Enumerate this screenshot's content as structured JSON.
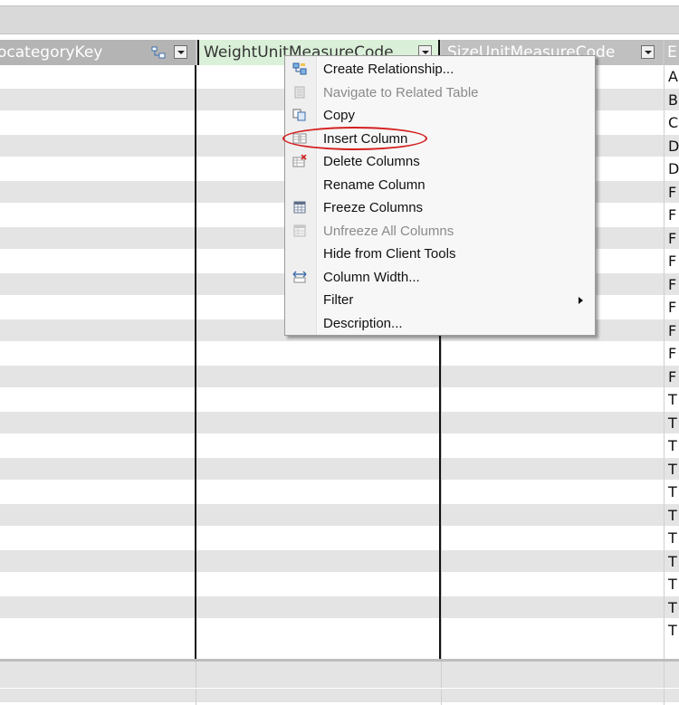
{
  "window": {
    "title_strip": ""
  },
  "columns": [
    {
      "label": "ocategoryKey",
      "icon": "relationship-icon"
    },
    {
      "label": "WeightUnitMeasureCode"
    },
    {
      "label": "SizeUnitMeasureCode"
    },
    {
      "label": "E"
    }
  ],
  "rows": [
    {
      "last_col": "A"
    },
    {
      "last_col": "B"
    },
    {
      "last_col": "C"
    },
    {
      "last_col": "D"
    },
    {
      "last_col": "D"
    },
    {
      "last_col": "F"
    },
    {
      "last_col": "F"
    },
    {
      "last_col": "F"
    },
    {
      "last_col": "F"
    },
    {
      "last_col": "F"
    },
    {
      "last_col": "F"
    },
    {
      "last_col": "F"
    },
    {
      "last_col": "F"
    },
    {
      "last_col": "F"
    },
    {
      "last_col": "T"
    },
    {
      "last_col": "T"
    },
    {
      "last_col": "T"
    },
    {
      "last_col": "T"
    },
    {
      "last_col": "T"
    },
    {
      "last_col": "T"
    },
    {
      "last_col": "T"
    },
    {
      "last_col": "T"
    },
    {
      "last_col": "T"
    },
    {
      "last_col": "T"
    },
    {
      "last_col": "T"
    }
  ],
  "context_menu": {
    "items": [
      {
        "label": "Create Relationship...",
        "icon": "create-relationship-icon",
        "enabled": true
      },
      {
        "label": "Navigate to Related Table",
        "icon": "navigate-table-icon",
        "enabled": false
      },
      {
        "label": "Copy",
        "icon": "copy-icon",
        "enabled": true
      },
      {
        "label": "Insert Column",
        "icon": "insert-column-icon",
        "enabled": true,
        "highlighted": true
      },
      {
        "label": "Delete Columns",
        "icon": "delete-columns-icon",
        "enabled": true
      },
      {
        "label": "Rename Column",
        "icon": "",
        "enabled": true
      },
      {
        "label": "Freeze Columns",
        "icon": "freeze-columns-icon",
        "enabled": true
      },
      {
        "label": "Unfreeze All Columns",
        "icon": "unfreeze-columns-icon",
        "enabled": false
      },
      {
        "label": "Hide from Client Tools",
        "icon": "",
        "enabled": true
      },
      {
        "label": "Column Width...",
        "icon": "column-width-icon",
        "enabled": true
      },
      {
        "label": "Filter",
        "icon": "",
        "enabled": true,
        "submenu": true
      },
      {
        "label": "Description...",
        "icon": "",
        "enabled": true
      }
    ]
  },
  "colors": {
    "selected_header": "#daf0d8",
    "annotation_oval": "#d42020"
  }
}
